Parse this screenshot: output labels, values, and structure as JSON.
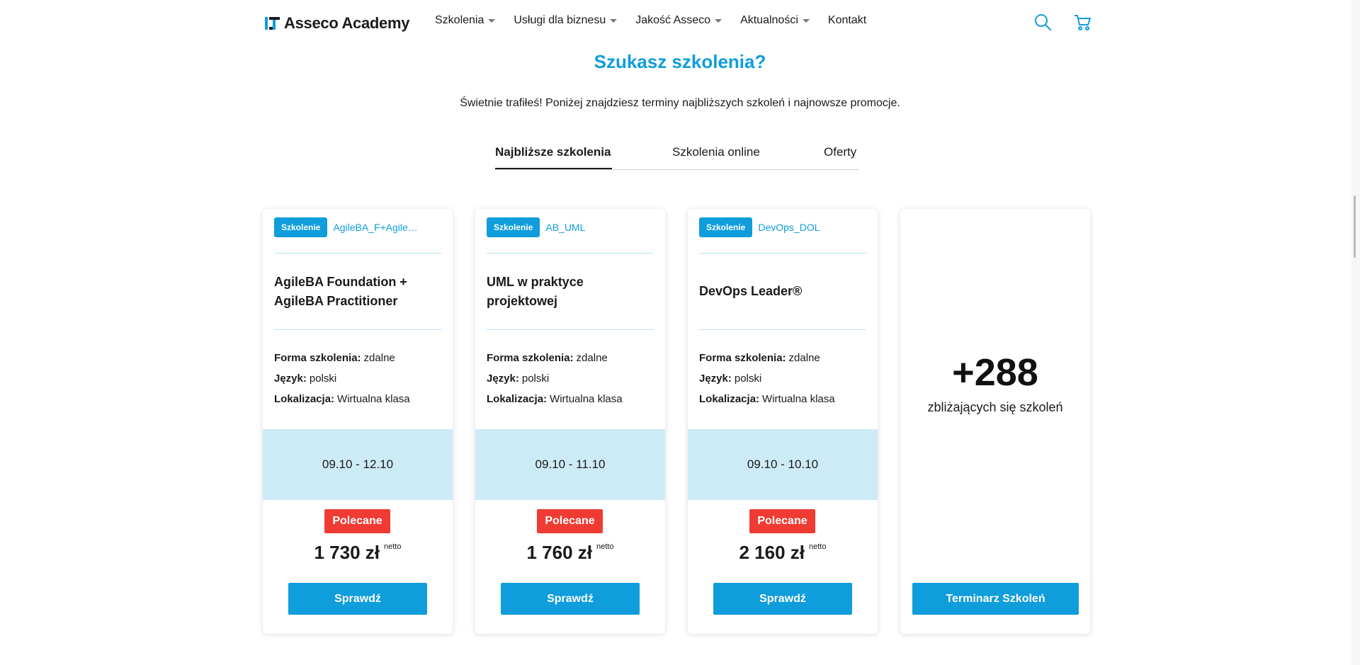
{
  "header": {
    "logo_text": "Asseco Academy",
    "nav": [
      {
        "label": "Szkolenia"
      },
      {
        "label": "Usługi dla biznesu"
      },
      {
        "label": "Jakość Asseco"
      },
      {
        "label": "Aktualności"
      },
      {
        "label": "Kontakt"
      }
    ],
    "icons": [
      "search-icon",
      "cart-icon"
    ]
  },
  "hero": {
    "title": "Szukasz szkolenia?",
    "subtitle": "Świetnie trafiłeś! Poniżej znajdziesz terminy najbliższych szkoleń i najnowsze promocje."
  },
  "tabs": [
    {
      "label": "Najbliższe szkolenia",
      "active": true
    },
    {
      "label": "Szkolenia online",
      "active": false
    },
    {
      "label": "Oferty",
      "active": false
    }
  ],
  "labels": {
    "form": "Forma szkolenia:",
    "language": "Język:",
    "location": "Lokalizacja:",
    "netto": "netto"
  },
  "courses": [
    {
      "badge": "Szkolenie",
      "code": "AgileBA_F+Agile…",
      "title": "AgileBA Foundation + AgileBA Practitioner",
      "form": "zdalne",
      "language": "polski",
      "location": "Wirtualna klasa",
      "dates": "09.10 - 12.10",
      "recommended": "Polecane",
      "price": "1 730 zł",
      "button": "Sprawdź"
    },
    {
      "badge": "Szkolenie",
      "code": "AB_UML",
      "title": "UML w praktyce projektowej",
      "form": "zdalne",
      "language": "polski",
      "location": "Wirtualna klasa",
      "dates": "09.10 - 11.10",
      "recommended": "Polecane",
      "price": "1 760 zł",
      "button": "Sprawdź"
    },
    {
      "badge": "Szkolenie",
      "code": "DevOps_DOL",
      "title": "DevOps Leader®",
      "form": "zdalne",
      "language": "polski",
      "location": "Wirtualna klasa",
      "dates": "09.10 - 10.10",
      "recommended": "Polecane",
      "price": "2 160 zł",
      "button": "Sprawdź"
    }
  ],
  "summary": {
    "count": "+288",
    "label": "zbliżających się szkoleń",
    "button": "Terminarz Szkoleń"
  },
  "colors": {
    "accent": "#0f9ddb",
    "date_band": "#cdebf7",
    "recommended": "#ef3b33"
  }
}
